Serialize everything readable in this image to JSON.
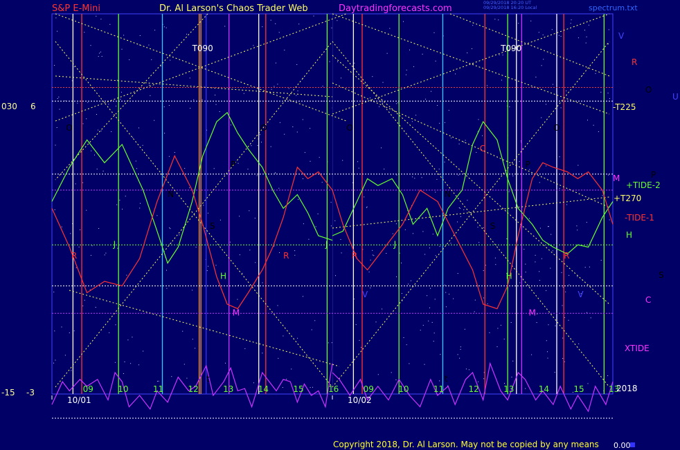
{
  "header": {
    "symbol": "S&P E-Mini",
    "title": "Dr. Al Larson's Chaos Trader Web",
    "website": "Daytradingforecasts.com",
    "timestamp_line1": "09/29/2018 20:20 UT",
    "timestamp_line2": "09/29/2018 16:20 Local",
    "filename": "spectrum.txt"
  },
  "footer": {
    "copyright": "Copyright 2018, Dr. Al Larson. May not be copied by any means",
    "value": "0.00"
  },
  "colors": {
    "background": "#000066",
    "plot_border": "#4444ff",
    "white": "#ffffff",
    "yellow": "#ffff66",
    "red": "#ff3333",
    "green": "#66ff33",
    "cyan": "#33ccff",
    "magenta": "#cc33ff",
    "orange": "#ff9933",
    "blue": "#3333ff",
    "grid_green": "#00cc00",
    "grid_red": "#cc0000",
    "label_red": "#ff3333",
    "label_green": "#66ff33",
    "label_magenta": "#ff33ff",
    "label_yellow": "#ffff66",
    "label_blue": "#4444ff",
    "footer_yellow": "#ffff33"
  },
  "chart_data": {
    "type": "line",
    "x_units": "hours",
    "xlim": [
      8,
      16
    ],
    "sessions": [
      {
        "date": "10/01",
        "hour_ticks": [
          "09",
          "10",
          "11",
          "12",
          "13",
          "14",
          "15",
          "16"
        ],
        "last_tick_label": "16"
      },
      {
        "date": "10/02",
        "hour_ticks": [
          "09",
          "10",
          "11",
          "12",
          "13",
          "14",
          "15",
          "16"
        ],
        "last_tick_label": "13"
      }
    ],
    "year_label": "2018",
    "left_scale_labels": [
      {
        "text": "030",
        "level": "upper"
      },
      {
        "text": "6",
        "level": "upper"
      },
      {
        "text": "-15",
        "level": "lower"
      },
      {
        "text": "-3",
        "level": "lower"
      }
    ],
    "vertical_markers": [
      {
        "session": 0,
        "x": 12.3,
        "label": "T090"
      },
      {
        "session": 1,
        "x": 13.1,
        "label": "T090"
      }
    ],
    "right_labels": [
      {
        "text": "V",
        "color": "blue"
      },
      {
        "text": "R",
        "color": "red"
      },
      {
        "text": "O",
        "color": "white"
      },
      {
        "text": "U",
        "color": "blue"
      },
      {
        "text": "-T225",
        "color": "yellow"
      },
      {
        "text": "M",
        "color": "magenta"
      },
      {
        "text": "P",
        "color": "white"
      },
      {
        "text": "+TIDE-2",
        "color": "green"
      },
      {
        "text": "+T270",
        "color": "yellow"
      },
      {
        "text": "-TIDE-1",
        "color": "red"
      },
      {
        "text": "H",
        "color": "green"
      },
      {
        "text": "S",
        "color": "white"
      },
      {
        "text": "C",
        "color": "magenta"
      },
      {
        "text": "XTIDE",
        "color": "magenta"
      }
    ],
    "plot_labels": [
      {
        "text": "O",
        "session": 0,
        "x": 8.4,
        "y": 0.76,
        "color": "white"
      },
      {
        "text": "O",
        "session": 0,
        "x": 13.95,
        "y": 0.76,
        "color": "white"
      },
      {
        "text": "O",
        "session": 1,
        "x": 8.4,
        "y": 0.76,
        "color": "white"
      },
      {
        "text": "O",
        "session": 1,
        "x": 14.3,
        "y": 0.76,
        "color": "white"
      },
      {
        "text": "P",
        "session": 0,
        "x": 13.1,
        "y": 0.6,
        "color": "white"
      },
      {
        "text": "P",
        "session": 1,
        "x": 13.5,
        "y": 0.6,
        "color": "white"
      },
      {
        "text": "N",
        "session": 0,
        "x": 11.3,
        "y": 0.47,
        "color": "cyan"
      },
      {
        "text": "N",
        "session": 1,
        "x": 11.2,
        "y": 0.47,
        "color": "cyan"
      },
      {
        "text": "S",
        "session": 0,
        "x": 12.5,
        "y": 0.33,
        "color": "white"
      },
      {
        "text": "S",
        "session": 1,
        "x": 12.5,
        "y": 0.33,
        "color": "white"
      },
      {
        "text": "C",
        "session": 1,
        "x": 12.2,
        "y": 0.67,
        "color": "red"
      },
      {
        "text": "J",
        "session": 0,
        "x": 9.75,
        "y": 0.25,
        "color": "green"
      },
      {
        "text": "J",
        "session": 0,
        "x": 15.8,
        "y": 0.25,
        "color": "green"
      },
      {
        "text": "J",
        "session": 1,
        "x": 9.75,
        "y": 0.25,
        "color": "green"
      },
      {
        "text": "R",
        "session": 0,
        "x": 8.55,
        "y": 0.2,
        "color": "red"
      },
      {
        "text": "R",
        "session": 0,
        "x": 14.6,
        "y": 0.2,
        "color": "red"
      },
      {
        "text": "R",
        "session": 1,
        "x": 8.55,
        "y": 0.2,
        "color": "red"
      },
      {
        "text": "R",
        "session": 1,
        "x": 14.6,
        "y": 0.2,
        "color": "red"
      },
      {
        "text": "H",
        "session": 0,
        "x": 12.8,
        "y": 0.11,
        "color": "green"
      },
      {
        "text": "H",
        "session": 1,
        "x": 12.95,
        "y": 0.11,
        "color": "green"
      },
      {
        "text": "V",
        "session": 1,
        "x": 8.85,
        "y": 0.03,
        "color": "blue"
      },
      {
        "text": "V",
        "session": 1,
        "x": 15.0,
        "y": 0.03,
        "color": "blue"
      },
      {
        "text": "M",
        "session": 0,
        "x": 13.15,
        "y": -0.05,
        "color": "magenta"
      },
      {
        "text": "M",
        "session": 1,
        "x": 13.6,
        "y": -0.05,
        "color": "magenta"
      },
      {
        "text": "t",
        "session": 0,
        "x": 12.4,
        "y": -0.34,
        "color": "white"
      },
      {
        "text": "t",
        "session": 1,
        "x": 11.2,
        "y": -0.34,
        "color": "white"
      }
    ],
    "series": [
      {
        "name": "+TIDE-2",
        "color": "green",
        "sessions": [
          {
            "x": [
              8.0,
              8.5,
              9.0,
              9.5,
              10.0,
              10.3,
              10.6,
              11.0,
              11.3,
              11.6,
              12.0,
              12.3,
              12.7,
              13.0,
              13.3,
              13.6,
              14.0,
              14.3,
              14.6,
              15.0,
              15.3,
              15.6,
              16.0
            ],
            "y": [
              0.45,
              0.6,
              0.72,
              0.62,
              0.7,
              0.6,
              0.5,
              0.32,
              0.18,
              0.25,
              0.45,
              0.65,
              0.8,
              0.84,
              0.75,
              0.68,
              0.6,
              0.5,
              0.42,
              0.48,
              0.4,
              0.3,
              0.28
            ]
          },
          {
            "x": [
              8.0,
              8.3,
              8.7,
              9.0,
              9.3,
              9.7,
              10.0,
              10.3,
              10.7,
              11.0,
              11.3,
              11.7,
              12.0,
              12.3,
              12.7,
              13.0,
              13.3,
              13.7,
              14.0,
              14.3,
              14.7,
              15.0,
              15.3,
              15.7,
              16.0
            ],
            "y": [
              0.3,
              0.32,
              0.45,
              0.55,
              0.52,
              0.55,
              0.48,
              0.35,
              0.42,
              0.3,
              0.42,
              0.5,
              0.7,
              0.8,
              0.72,
              0.55,
              0.42,
              0.35,
              0.28,
              0.25,
              0.22,
              0.26,
              0.25,
              0.38,
              0.45
            ]
          }
        ]
      },
      {
        "name": "-TIDE-1",
        "color": "red",
        "sessions": [
          {
            "x": [
              8.0,
              8.5,
              9.0,
              9.5,
              10.0,
              10.5,
              11.0,
              11.5,
              12.0,
              12.3,
              12.7,
              13.0,
              13.3,
              13.6,
              14.0,
              14.3,
              14.6,
              15.0,
              15.3,
              15.6,
              16.0
            ],
            "y": [
              0.42,
              0.25,
              0.05,
              0.1,
              0.08,
              0.2,
              0.45,
              0.65,
              0.5,
              0.35,
              0.12,
              0.0,
              -0.02,
              0.05,
              0.15,
              0.25,
              0.38,
              0.6,
              0.55,
              0.58,
              0.5
            ]
          },
          {
            "x": [
              8.0,
              8.3,
              8.7,
              9.0,
              9.5,
              10.0,
              10.5,
              11.0,
              11.5,
              12.0,
              12.3,
              12.7,
              13.0,
              13.3,
              13.7,
              14.0,
              14.3,
              14.7,
              15.0,
              15.3,
              15.7,
              16.0
            ],
            "y": [
              0.5,
              0.35,
              0.2,
              0.15,
              0.25,
              0.35,
              0.5,
              0.45,
              0.3,
              0.15,
              0.0,
              -0.02,
              0.08,
              0.3,
              0.55,
              0.62,
              0.6,
              0.58,
              0.55,
              0.58,
              0.5,
              0.35
            ]
          }
        ]
      },
      {
        "name": "XTIDE",
        "color": "magenta",
        "sessions": [
          {
            "x": [
              8.0,
              8.3,
              8.5,
              8.8,
              9.0,
              9.3,
              9.6,
              9.8,
              10.0,
              10.2,
              10.5,
              10.8,
              11.0,
              11.3,
              11.6,
              11.9,
              12.1,
              12.4,
              12.6,
              12.9,
              13.1,
              13.3,
              13.5,
              13.7,
              14.0,
              14.2,
              14.4,
              14.6,
              14.8,
              15.0,
              15.2,
              15.4,
              15.6,
              15.8,
              16.0
            ],
            "y": [
              -0.44,
              -0.34,
              -0.38,
              -0.33,
              -0.36,
              -0.33,
              -0.42,
              -0.3,
              -0.34,
              -0.45,
              -0.4,
              -0.46,
              -0.38,
              -0.43,
              -0.32,
              -0.38,
              -0.36,
              -0.27,
              -0.4,
              -0.34,
              -0.28,
              -0.38,
              -0.37,
              -0.45,
              -0.3,
              -0.34,
              -0.38,
              -0.33,
              -0.34,
              -0.43,
              -0.35,
              -0.4,
              -0.38,
              -0.45,
              -0.26
            ]
          },
          {
            "x": [
              8.0,
              8.2,
              8.5,
              8.8,
              9.0,
              9.3,
              9.6,
              9.9,
              10.2,
              10.5,
              10.8,
              11.0,
              11.3,
              11.5,
              11.8,
              12.0,
              12.3,
              12.5,
              12.8,
              13.0,
              13.3,
              13.5,
              13.8,
              14.0,
              14.3,
              14.5,
              14.8,
              15.0,
              15.3,
              15.5,
              15.8,
              16.0
            ],
            "y": [
              -0.3,
              -0.33,
              -0.4,
              -0.33,
              -0.42,
              -0.36,
              -0.42,
              -0.33,
              -0.4,
              -0.45,
              -0.33,
              -0.4,
              -0.36,
              -0.44,
              -0.33,
              -0.3,
              -0.42,
              -0.26,
              -0.38,
              -0.42,
              -0.3,
              -0.33,
              -0.42,
              -0.38,
              -0.44,
              -0.36,
              -0.46,
              -0.4,
              -0.47,
              -0.36,
              -0.44,
              -0.34
            ]
          }
        ]
      }
    ],
    "horizontal_lines": [
      {
        "y": 0.95,
        "style": "dotted",
        "color": "red"
      },
      {
        "y": 0.89,
        "style": "dotted",
        "color": "white"
      },
      {
        "y": 0.57,
        "style": "dotted",
        "color": "white"
      },
      {
        "y": 0.5,
        "style": "dotted",
        "color": "magenta"
      },
      {
        "y": 0.26,
        "style": "dotted",
        "color": "green"
      },
      {
        "y": 0.08,
        "style": "dotted",
        "color": "white"
      },
      {
        "y": -0.04,
        "style": "dotted",
        "color": "magenta"
      },
      {
        "y": -0.5,
        "style": "dotted",
        "color": "white"
      }
    ],
    "vertical_lines": [
      {
        "session": 0,
        "x": 8.6,
        "color": "white"
      },
      {
        "session": 0,
        "x": 8.85,
        "color": "red"
      },
      {
        "session": 0,
        "x": 9.9,
        "color": "green"
      },
      {
        "session": 0,
        "x": 11.15,
        "color": "cyan"
      },
      {
        "session": 0,
        "x": 12.2,
        "color": "orange"
      },
      {
        "session": 0,
        "x": 12.25,
        "color": "orange"
      },
      {
        "session": 0,
        "x": 12.4,
        "color": "blue"
      },
      {
        "session": 0,
        "x": 13.05,
        "color": "magenta"
      },
      {
        "session": 0,
        "x": 13.9,
        "color": "white"
      },
      {
        "session": 0,
        "x": 14.1,
        "color": "red"
      },
      {
        "session": 0,
        "x": 15.85,
        "color": "green"
      },
      {
        "session": 1,
        "x": 8.6,
        "color": "white"
      },
      {
        "session": 1,
        "x": 8.85,
        "color": "red"
      },
      {
        "session": 1,
        "x": 9.9,
        "color": "green"
      },
      {
        "session": 1,
        "x": 11.15,
        "color": "cyan"
      },
      {
        "session": 1,
        "x": 12.35,
        "color": "red"
      },
      {
        "session": 1,
        "x": 13.0,
        "color": "green"
      },
      {
        "session": 1,
        "x": 13.25,
        "color": "white"
      },
      {
        "session": 1,
        "x": 13.4,
        "color": "magenta"
      },
      {
        "session": 1,
        "x": 14.4,
        "color": "white"
      },
      {
        "session": 1,
        "x": 14.6,
        "color": "red"
      },
      {
        "session": 1,
        "x": 15.75,
        "color": "green"
      }
    ]
  }
}
